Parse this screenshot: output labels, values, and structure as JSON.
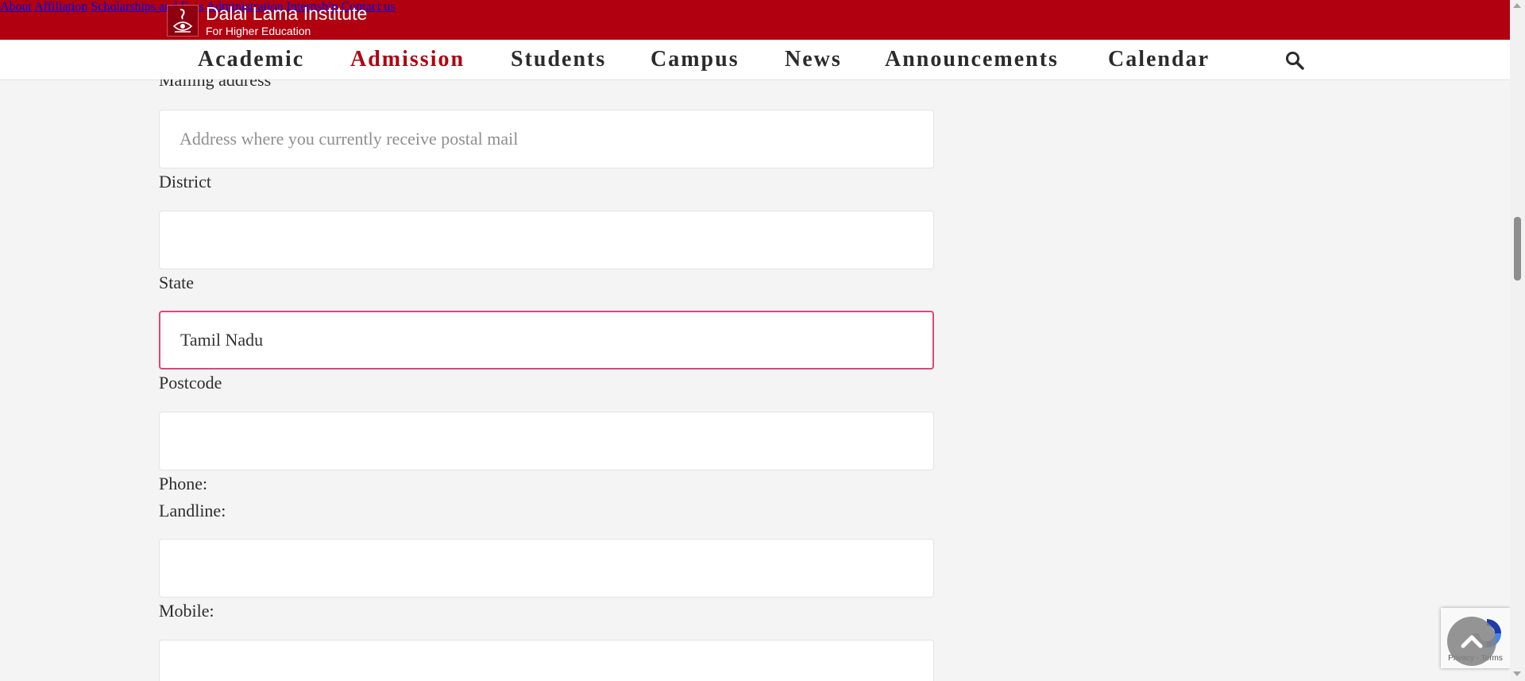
{
  "brand": {
    "title": "Dalai Lama Institute",
    "subtitle": "For Higher Education",
    "accent_color": "#b1000f"
  },
  "top_nav": [
    "About",
    "Affiliation",
    "Scholarships and Fees",
    "Administration",
    "Internship",
    "Contact us"
  ],
  "main_nav": [
    "Academic",
    "Admission",
    "Students",
    "Campus",
    "News",
    "Announcements",
    "Calendar"
  ],
  "main_nav_active": "Admission",
  "form": {
    "mailing_label": "Mailing address",
    "mailing_placeholder": "Address where you currently receive postal mail",
    "mailing_value": "",
    "district_label": "District",
    "district_value": "",
    "state_label": "State",
    "state_value": "Tamil Nadu",
    "postcode_label": "Postcode",
    "postcode_value": "",
    "phone_label": "Phone:",
    "landline_label": "Landline:",
    "landline_value": "",
    "mobile_label": "Mobile:",
    "mobile_value": ""
  },
  "recaptcha": {
    "links": "Privacy - Terms"
  },
  "icons": {
    "search": "search-icon",
    "back_to_top": "chevron-up-icon",
    "recaptcha": "recaptcha-icon"
  }
}
